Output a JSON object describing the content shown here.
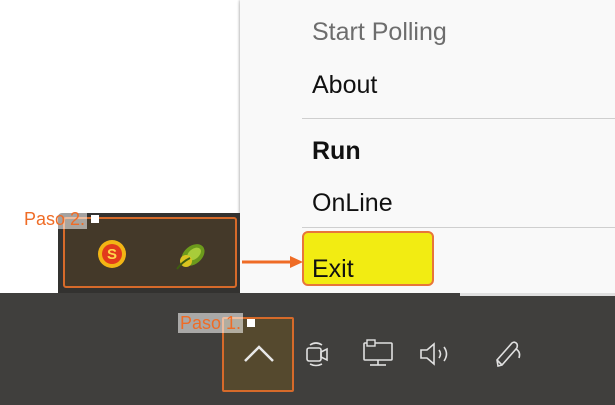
{
  "context_menu": {
    "items": [
      {
        "label": "Start Polling",
        "state": "disabled"
      },
      {
        "label": "About",
        "state": "normal"
      },
      {
        "label": "Run",
        "state": "bold"
      },
      {
        "label": "OnLine",
        "state": "normal"
      },
      {
        "label": "Exit",
        "state": "highlighted"
      }
    ]
  },
  "annotations": {
    "step1": "Paso 1.",
    "step2": "Paso 2."
  },
  "tray_popup": {
    "icons": [
      "s-app-icon",
      "green-leaf-app-icon"
    ]
  },
  "taskbar": {
    "icons": [
      "chevron-up-icon",
      "camera-icon",
      "network-icon",
      "volume-icon",
      "pen-icon"
    ]
  },
  "colors": {
    "highlight_fill": "#f2ec12",
    "annotation_orange": "#ef6c26",
    "taskbar_bg": "#403f3d"
  }
}
